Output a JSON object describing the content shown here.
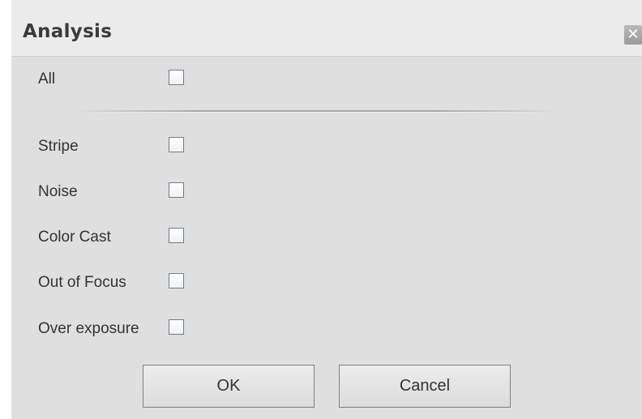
{
  "dialog": {
    "title": "Analysis",
    "close_label": "✕"
  },
  "all_option": {
    "label": "All",
    "checked": false
  },
  "options": [
    {
      "label": "Stripe",
      "checked": false
    },
    {
      "label": "Noise",
      "checked": false
    },
    {
      "label": "Color Cast",
      "checked": false
    },
    {
      "label": "Out of Focus",
      "checked": false
    },
    {
      "label": "Over exposure",
      "checked": false
    }
  ],
  "buttons": {
    "ok_label": "OK",
    "cancel_label": "Cancel"
  },
  "colors": {
    "dialog_bg": "#dfdfdf",
    "title_bg": "#ebebeb",
    "checkbox_border": "#6b7f94"
  }
}
